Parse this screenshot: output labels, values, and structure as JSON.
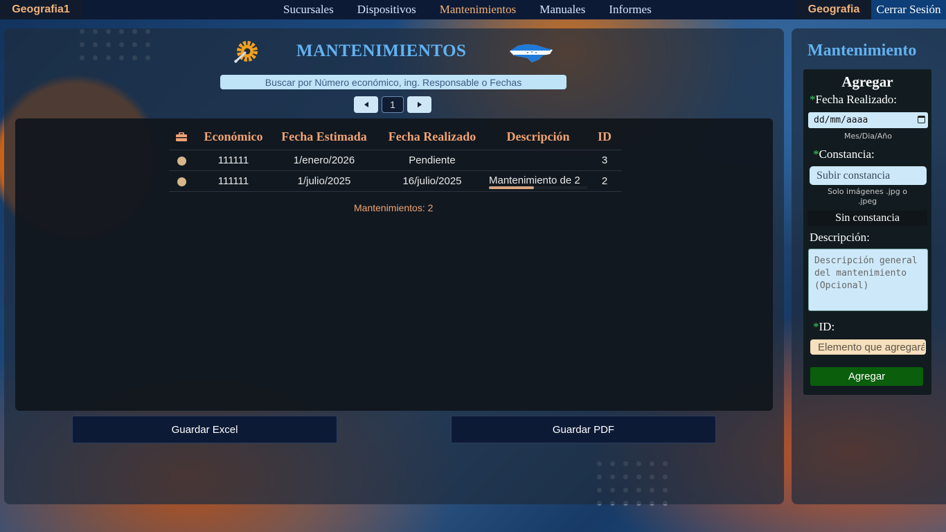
{
  "nav": {
    "brand": "Geografia1",
    "links": [
      "Sucursales",
      "Dispositivos",
      "Mantenimientos",
      "Manuales",
      "Informes"
    ],
    "active": "Mantenimientos",
    "user": "Geografia",
    "logout": "Cerrar Sesión"
  },
  "main": {
    "title": "MANTENIMIENTOS",
    "search_placeholder": "Buscar por Número económico, ing. Responsable o Fechas",
    "current_page": "1",
    "table": {
      "headers": [
        "Económico",
        "Fecha Estimada",
        "Fecha Realizado",
        "Descripción",
        "ID"
      ],
      "rows": [
        {
          "economico": "111111",
          "fecha_estimada": "1/enero/2026",
          "fecha_realizado": "Pendiente",
          "descripcion": "",
          "id": "3"
        },
        {
          "economico": "111111",
          "fecha_estimada": "1/julio/2025",
          "fecha_realizado": "16/julio/2025",
          "descripcion": "Mantenimiento de 2",
          "id": "2"
        }
      ]
    },
    "count_label": "Mantenimientos: 2",
    "excel_button": "Guardar Excel",
    "pdf_button": "Guardar PDF"
  },
  "side": {
    "title": "Mantenimiento",
    "form_title": "Agregar",
    "fecha_label": "Fecha Realizado:",
    "date_placeholder": "dd/mm/aaaa",
    "date_hint": "Mes/Dia/Año",
    "constancia_label": "Constancia:",
    "upload_label": "Subir constancia",
    "upload_hint": "Solo imágenes .jpg o .jpeg",
    "no_file": "Sin constancia",
    "descripcion_label": "Descripción:",
    "descripcion_placeholder": "Descripción general del mantenimiento (Opcional)",
    "id_label": "ID:",
    "id_placeholder": "Elemento que agregará",
    "required_mark": "*",
    "submit": "Agregar"
  },
  "colors": {
    "accent_blue": "#63b2f0",
    "accent_orange": "#f0a374",
    "nav_bg": "#0d1a36",
    "submit_green": "#0a5e0c"
  }
}
